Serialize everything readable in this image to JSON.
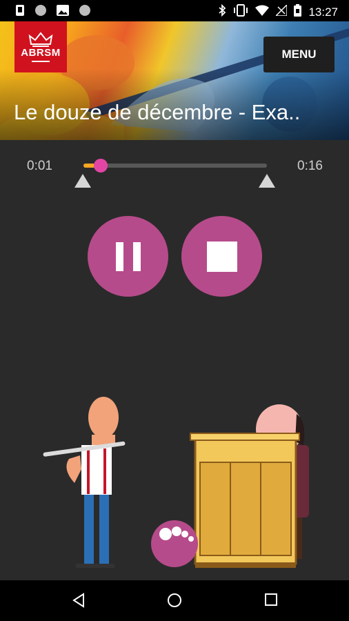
{
  "status_bar": {
    "time": "13:27",
    "left_icons": [
      "notification-phone-icon",
      "circle-dot-icon",
      "image-icon",
      "circle-dot-icon"
    ],
    "right_icons": [
      "bluetooth-icon",
      "vibrate-icon",
      "wifi-icon",
      "no-signal-icon",
      "battery-icon"
    ]
  },
  "header": {
    "logo_text": "ABRSM",
    "menu_label": "MENU",
    "title": "Le douze de décembre - Exa.."
  },
  "player": {
    "elapsed": "0:01",
    "total": "0:16",
    "progress_fraction": 0.0625,
    "buttons": [
      "pause-icon",
      "stop-icon"
    ]
  },
  "colors": {
    "accent": "#b64b8b",
    "thumb": "#e246a5",
    "logo": "#d0121f",
    "background": "#2a2a2a"
  },
  "nav": {
    "buttons": [
      "back-icon",
      "home-icon",
      "recents-icon"
    ]
  }
}
